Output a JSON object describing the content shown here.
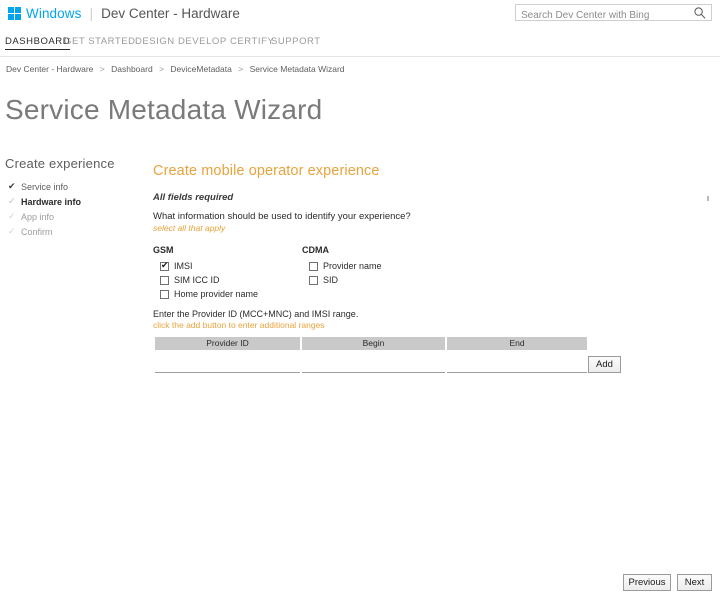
{
  "topbar": {
    "logo_icon": "windows-logo-icon",
    "brand": "Windows",
    "separator": "|",
    "site": "Dev Center - Hardware",
    "search": {
      "placeholder": "Search Dev Center with Bing",
      "value": "",
      "icon": "search-icon"
    }
  },
  "nav": {
    "items": [
      {
        "label": "DASHBOARD",
        "active": true
      },
      {
        "label": "GET STARTED",
        "active": false
      },
      {
        "label": "DESIGN",
        "active": false
      },
      {
        "label": "DEVELOP",
        "active": false
      },
      {
        "label": "CERTIFY",
        "active": false
      },
      {
        "label": "SUPPORT",
        "active": false
      }
    ]
  },
  "breadcrumb": {
    "separator": ">",
    "items": [
      "Dev Center - Hardware",
      "Dashboard",
      "DeviceMetadata",
      "Service Metadata Wizard"
    ]
  },
  "page": {
    "title": "Service Metadata Wizard"
  },
  "steps": {
    "heading": "Create experience",
    "items": [
      {
        "label": "Service info",
        "tick": "✔",
        "state": "done"
      },
      {
        "label": "Hardware info",
        "tick": "✓",
        "state": "current"
      },
      {
        "label": "App info",
        "tick": "✓",
        "state": "pending"
      },
      {
        "label": "Confirm",
        "tick": "✓",
        "state": "pending"
      }
    ]
  },
  "form": {
    "title": "Create mobile operator experience",
    "all_fields_required": "All fields required",
    "question": "What information should be used to identify your experience?",
    "select_hint": "select all that apply",
    "groups": [
      {
        "name": "GSM",
        "options": [
          {
            "label": "IMSI",
            "checked": true
          },
          {
            "label": "SIM ICC ID",
            "checked": false
          },
          {
            "label": "Home provider name",
            "checked": false
          }
        ]
      },
      {
        "name": "CDMA",
        "options": [
          {
            "label": "Provider name",
            "checked": false
          },
          {
            "label": "SID",
            "checked": false
          }
        ]
      }
    ],
    "range_intro": "Enter the Provider ID (MCC+MNC) and IMSI range.",
    "range_hint": "click the add button to enter additional ranges",
    "table": {
      "columns": [
        "Provider ID",
        "Begin",
        "End"
      ],
      "rows": [
        {
          "provider_id": "",
          "begin": "",
          "end": ""
        }
      ]
    },
    "add_label": "Add"
  },
  "footer": {
    "previous_label": "Previous",
    "next_label": "Next"
  },
  "colors": {
    "brand_blue": "#00a4ef",
    "accent_orange": "#e8a33d",
    "header_gray": "#c9c9c9",
    "title_gray": "#7a7a7a"
  }
}
